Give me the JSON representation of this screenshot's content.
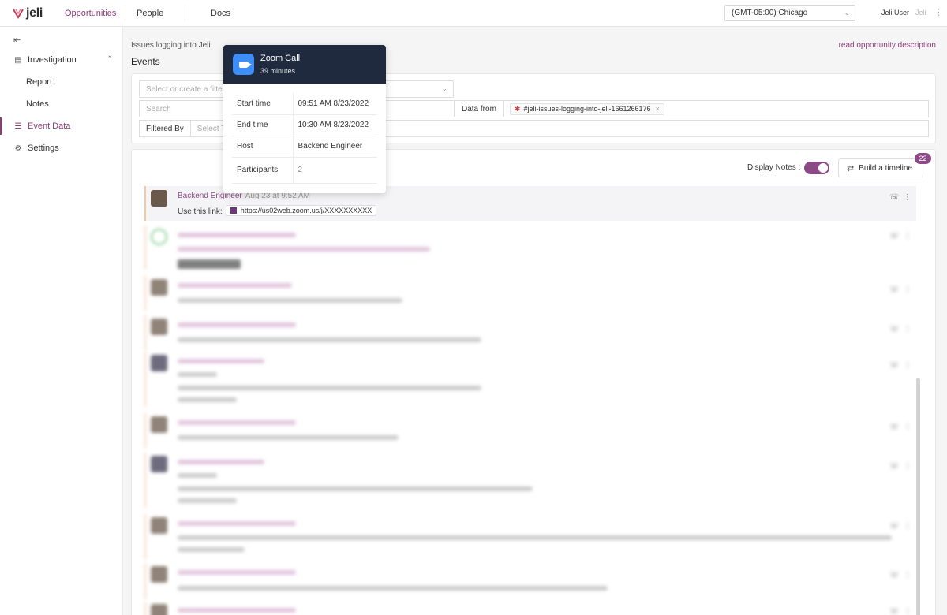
{
  "nav": {
    "logo_text": "jeli",
    "links": [
      "Opportunities",
      "People",
      "Docs"
    ],
    "timezone": "(GMT-05:00) Chicago",
    "user_name": "Jeli User",
    "user_org": "Jeli"
  },
  "sidebar": {
    "items": [
      {
        "label": "Investigation",
        "icon": "clipboard-icon"
      },
      {
        "label": "Report"
      },
      {
        "label": "Notes"
      },
      {
        "label": "Event Data",
        "icon": "list-icon"
      },
      {
        "label": "Settings",
        "icon": "gear-icon"
      }
    ]
  },
  "main": {
    "breadcrumb": "Issues logging into Jeli",
    "title": "Events",
    "read_link": "read opportunity description"
  },
  "filters": {
    "select_placeholder": "Select or create a filter",
    "search_placeholder": "Search",
    "data_from_label": "Data from",
    "data_from_chip": "#jeli-issues-logging-into-jeli-1661266176",
    "filtered_by_label": "Filtered By",
    "filtered_by_placeholder": "Select Tags"
  },
  "feed": {
    "display_notes_label": "Display Notes :",
    "display_notes_on": true,
    "build_timeline_label": "Build a timeline",
    "badge_count": "22",
    "first_event": {
      "author": "Backend Engineer",
      "time": "Aug 23 at 9:52 AM",
      "text_prefix": "Use this link:",
      "link": "https://us02web.zoom.us/j/XXXXXXXXXX"
    }
  },
  "popover": {
    "title": "Zoom Call",
    "subtitle": "39 minutes",
    "rows": [
      {
        "key": "Start time",
        "value": "09:51 AM 8/23/2022"
      },
      {
        "key": "End time",
        "value": "10:30 AM 8/23/2022"
      },
      {
        "key": "Host",
        "value": "Backend Engineer"
      },
      {
        "key": "Participants",
        "value": "2"
      }
    ]
  },
  "colors": {
    "accent": "#8b3d7a",
    "popover_header": "#1f2a3e",
    "zoom_blue": "#3e8ef7"
  }
}
